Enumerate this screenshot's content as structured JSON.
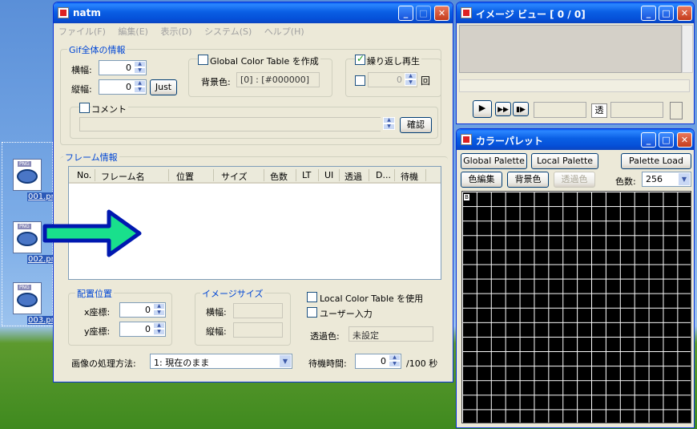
{
  "desktop": {
    "icons": [
      {
        "label": "001.png",
        "badge": "PNG"
      },
      {
        "label": "002.png",
        "badge": "PNG"
      },
      {
        "label": "003.png",
        "badge": "PNG"
      }
    ]
  },
  "main_window": {
    "title": "natm",
    "menu": [
      "ファイル(F)",
      "編集(E)",
      "表示(D)",
      "システム(S)",
      "ヘルプ(H)"
    ],
    "gif_info": {
      "title": "Gif全体の情報",
      "width_label": "横幅:",
      "width_value": "0",
      "height_label": "縦幅:",
      "height_value": "0",
      "just_button": "Just",
      "global_color_table_label": "Global Color Table を作成",
      "bg_color_label": "背景色:",
      "bg_color_value": "[0] : [#000000]",
      "loop_label": "繰り返し再生",
      "loop_value": "0",
      "comment_label": "コメント",
      "confirm_button": "確認"
    },
    "frame_info": {
      "title": "フレーム情報",
      "columns": [
        "No.",
        "フレーム名",
        "位置",
        "サイズ",
        "色数",
        "LT",
        "UI",
        "透過",
        "D...",
        "待機"
      ]
    },
    "placement": {
      "title": "配置位置",
      "x_label": "x座標:",
      "x_value": "0",
      "y_label": "y座標:",
      "y_value": "0"
    },
    "image_size": {
      "title": "イメージサイズ",
      "w_label": "横幅:",
      "h_label": "縦幅:"
    },
    "local_color_table_label": "Local Color Table を使用",
    "user_input_label": "ユーザー入力",
    "transparent_label": "透過色:",
    "transparent_value": "未設定",
    "process_label": "画像の処理方法:",
    "process_value": "1: 現在のまま",
    "wait_label": "待機時間:",
    "wait_value": "0",
    "wait_unit": "/100 秒"
  },
  "image_view": {
    "title": "イメージ ビュー  [ 0 /  0]",
    "transparent_button": "透"
  },
  "palette": {
    "title": "カラーパレット",
    "global_button": "Global Palette",
    "local_button": "Local Palette",
    "load_button": "Palette Load",
    "edit_button": "色編集",
    "bg_button": "背景色",
    "trans_button": "透過色",
    "count_label": "色数:",
    "count_value": "256"
  },
  "colors": {
    "title_blue": "#0a5fe4",
    "group_title": "#0046d5",
    "arrow_fill": "#19e08c",
    "arrow_stroke": "#0018b0"
  }
}
